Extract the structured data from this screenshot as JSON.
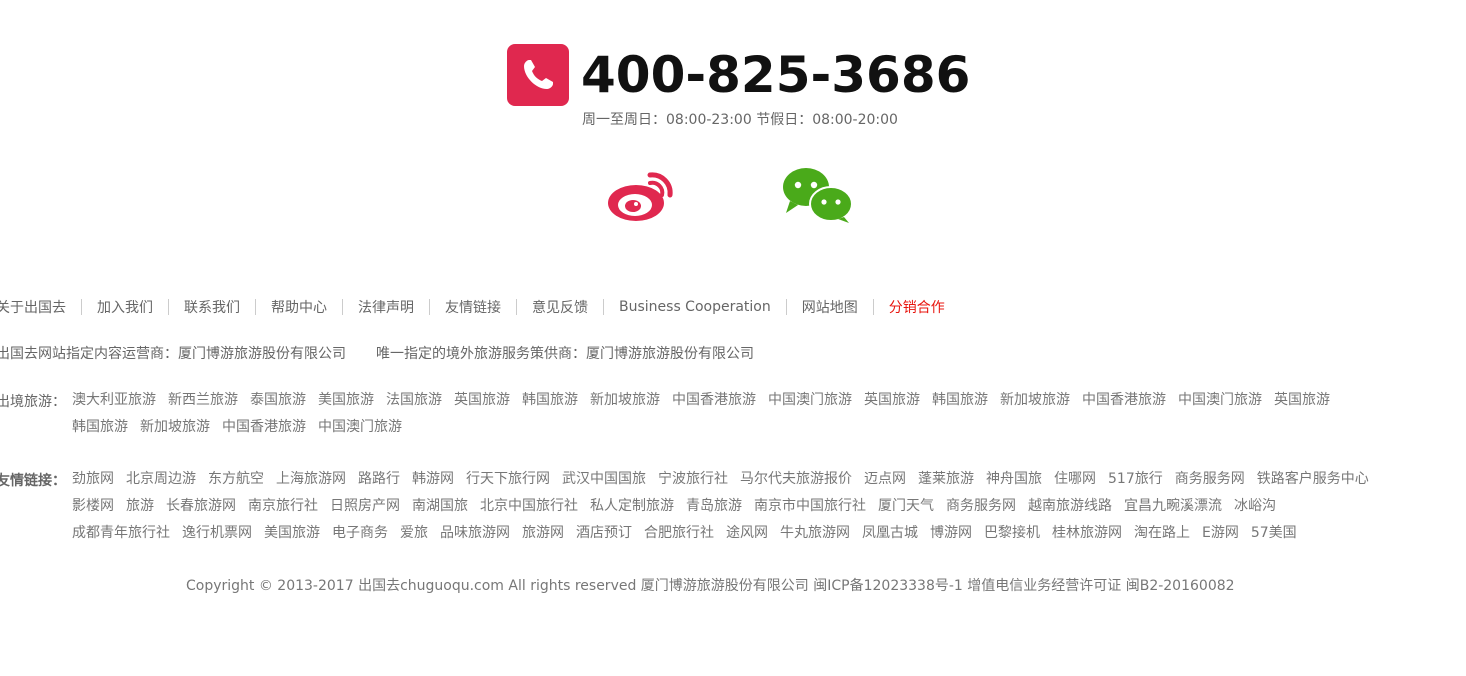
{
  "contact": {
    "phone": "400-825-3686",
    "hours": "周一至周日：08:00-23:00 节假日：08:00-20:00"
  },
  "social": {
    "weibo_icon": "weibo-icon",
    "wechat_icon": "wechat-icon"
  },
  "about_links": [
    "关于出国去",
    "加入我们",
    "联系我们",
    "帮助中心",
    "法律声明",
    "友情链接",
    "意见反馈",
    "Business Cooperation",
    "网站地图",
    "分销合作"
  ],
  "operator": {
    "content": "出国去网站指定内容运营商：厦门博游旅游股份有限公司",
    "service": "唯一指定的境外旅游服务策供商：厦门博游旅游股份有限公司"
  },
  "outbound": {
    "label": "出境旅游：",
    "lines": [
      [
        "澳大利亚旅游",
        "新西兰旅游",
        "泰国旅游",
        "美国旅游",
        "法国旅游",
        "英国旅游",
        "韩国旅游",
        "新加坡旅游",
        "中国香港旅游",
        "中国澳门旅游",
        "英国旅游",
        "韩国旅游",
        "新加坡旅游",
        "中国香港旅游",
        "中国澳门旅游",
        "英国旅游"
      ],
      [
        "韩国旅游",
        "新加坡旅游",
        "中国香港旅游",
        "中国澳门旅游"
      ]
    ]
  },
  "friends": {
    "label": "友情链接：",
    "lines": [
      [
        "劲旅网",
        "北京周边游",
        "东方航空",
        "上海旅游网",
        "路路行",
        "韩游网",
        "行天下旅行网",
        "武汉中国国旅",
        "宁波旅行社",
        "马尔代夫旅游报价",
        "迈点网",
        "蓬莱旅游",
        "神舟国旅",
        "住哪网",
        "517旅行",
        "商务服务网",
        "铁路客户服务中心"
      ],
      [
        "影楼网",
        "旅游",
        "长春旅游网",
        "南京旅行社",
        "日照房产网",
        "南湖国旅",
        "北京中国旅行社",
        "私人定制旅游",
        "青岛旅游",
        "南京市中国旅行社",
        "厦门天气",
        "商务服务网",
        "越南旅游线路",
        "宜昌九畹溪漂流",
        "冰峪沟"
      ],
      [
        "成都青年旅行社",
        "逸行机票网",
        "美国旅游",
        "电子商务",
        "爱旅",
        "品味旅游网",
        "旅游网",
        "酒店预订",
        "合肥旅行社",
        "途风网",
        "牛丸旅游网",
        "凤凰古城",
        "博游网",
        "巴黎接机",
        "桂林旅游网",
        "淘在路上",
        "E游网",
        "57美国"
      ]
    ]
  },
  "copyright": "Copyright © 2013-2017 出国去chuguoqu.com All rights reserved 厦门博游旅游股份有限公司 闽ICP备12023338号-1 增值电信业务经营许可证 闽B2-20160082",
  "colors": {
    "phone_icon_bg": "#e0284f",
    "weibo_red": "#e0284f",
    "wechat_green": "#4aaa1a",
    "highlight_link": "#e8160f"
  }
}
